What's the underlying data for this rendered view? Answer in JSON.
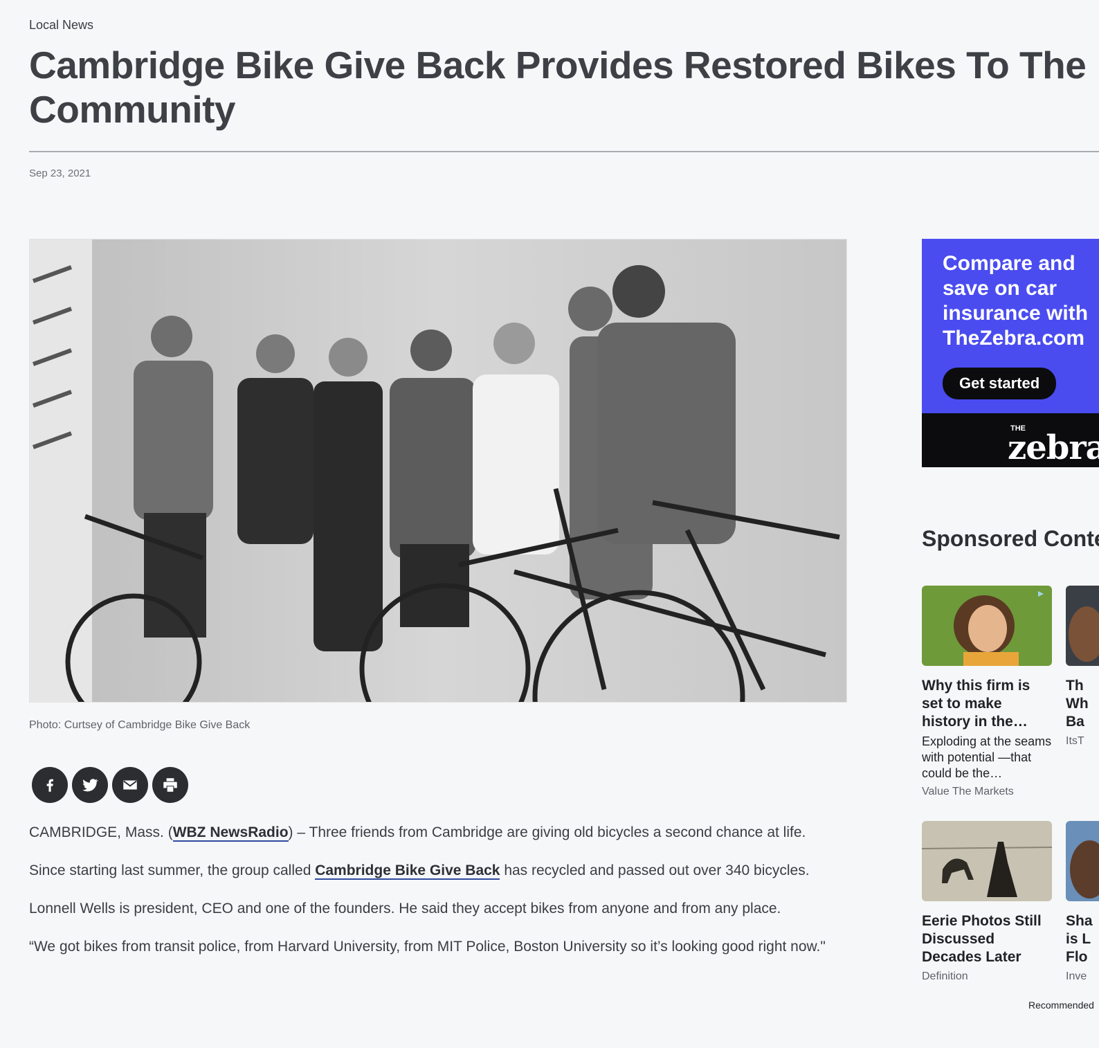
{
  "article": {
    "category": "Local News",
    "headline": "Cambridge Bike Give Back Provides Restored Bikes To The Community",
    "date": "Sep 23, 2021",
    "photo_caption": "Photo: Curtsey of Cambridge Bike Give Back",
    "p1_prefix": "CAMBRIDGE, Mass. (",
    "p1_link": "WBZ NewsRadio",
    "p1_suffix": ") – Three friends from Cambridge are giving old bicycles a second chance at life.",
    "p2_prefix": "Since starting last summer, the group called ",
    "p2_link": "Cambridge Bike Give Back",
    "p2_suffix": " has recycled and passed out over 340 bicycles.",
    "p3": "Lonnell Wells is president, CEO and one of the founders. He said they accept bikes from anyone and from any place.",
    "p4": "“We got bikes from transit police, from Harvard University, from MIT Police, Boston University so it’s looking good right now.\""
  },
  "share": {
    "icons": [
      "facebook-icon",
      "twitter-icon",
      "email-icon",
      "print-icon"
    ]
  },
  "ad": {
    "line1": "Compare and",
    "line2": "save on car",
    "line3": "insurance with",
    "line4": "TheZebra.com",
    "cta": "Get started",
    "logo_small": "THE",
    "logo": "zebra",
    "accent_color": "#4a4cf0"
  },
  "sponsored": {
    "title": "Sponsored Content",
    "cards": [
      {
        "title": "Why this firm is set to make history in the…",
        "desc": "Exploding at the seams with potential —that could be the…",
        "source": "Value The Markets"
      },
      {
        "title": "Th Wh Ba",
        "source": "ItsT"
      },
      {
        "title": "Eerie Photos Still Discussed Decades Later",
        "source": "Definition"
      },
      {
        "title": "Sha is L Flo",
        "source": "Inve"
      }
    ],
    "recommended": "Recommended"
  }
}
